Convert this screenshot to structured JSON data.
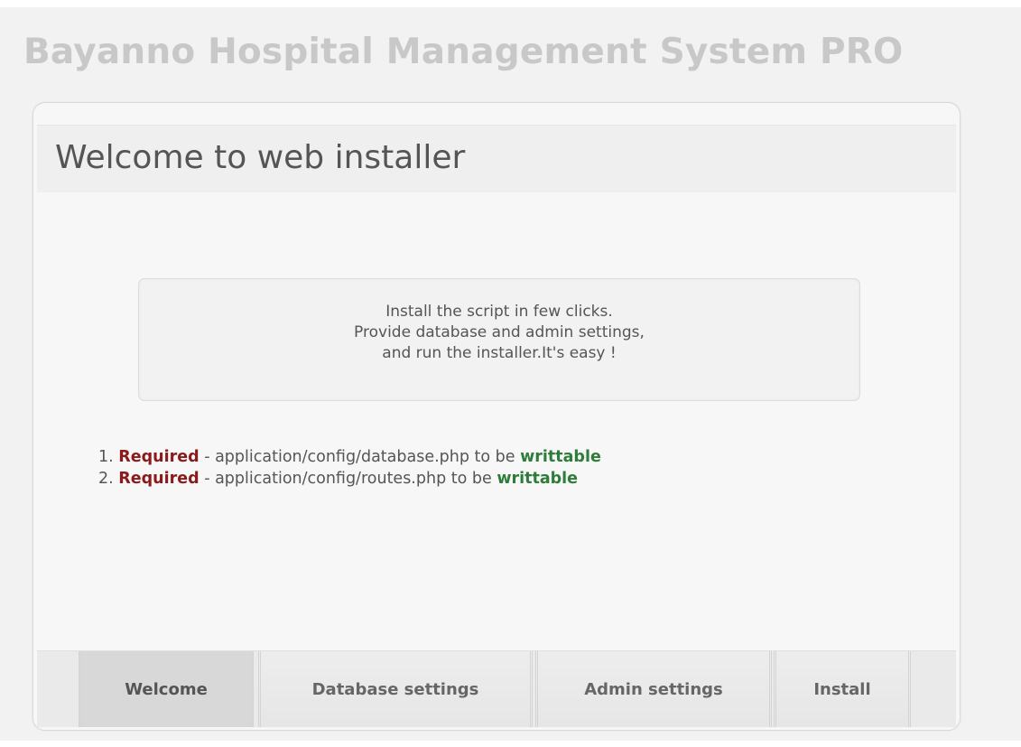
{
  "app": {
    "title": "Bayanno Hospital Management System PRO"
  },
  "panel": {
    "heading": "Welcome to web installer"
  },
  "intro": {
    "lines": [
      "Install the script in few clicks.",
      "Provide database and admin settings,",
      "and run the installer.It's easy !"
    ]
  },
  "requirements": [
    {
      "number": "1.",
      "required_label": "Required",
      "middle_text": " - application/config/database.php to be ",
      "status": "writtable"
    },
    {
      "number": "2.",
      "required_label": "Required",
      "middle_text": " - application/config/routes.php to be ",
      "status": "writtable"
    }
  ],
  "nav": {
    "tabs": [
      {
        "label": "Welcome",
        "active": true
      },
      {
        "label": "Database settings",
        "active": false
      },
      {
        "label": "Admin settings",
        "active": false
      },
      {
        "label": "Install",
        "active": false
      }
    ]
  },
  "colors": {
    "required": "#8b1a1a",
    "writable": "#2e7d3a",
    "title": "#c8c8c8"
  }
}
